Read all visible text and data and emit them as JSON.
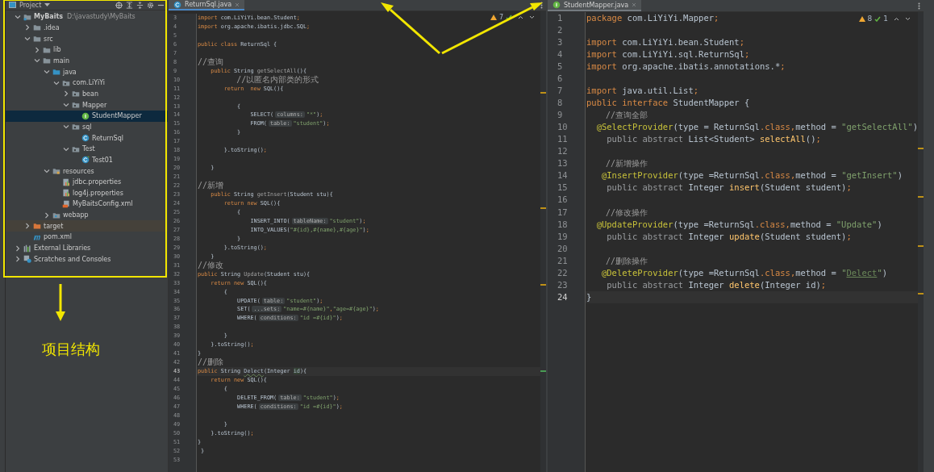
{
  "project_panel": {
    "title": "Project",
    "tree": [
      {
        "label": "MyBaits",
        "path": "D:\\javastudy\\MyBaits",
        "kind": "module",
        "expanded": true,
        "selected": false,
        "children": [
          {
            "label": ".idea",
            "kind": "folder",
            "expanded": false,
            "selected": false
          },
          {
            "label": "src",
            "kind": "folder",
            "expanded": true,
            "selected": false,
            "children": [
              {
                "label": "lib",
                "kind": "folder",
                "expanded": false,
                "selected": false
              },
              {
                "label": "main",
                "kind": "folder",
                "expanded": true,
                "selected": false,
                "children": [
                  {
                    "label": "java",
                    "kind": "source-folder",
                    "expanded": true,
                    "selected": false,
                    "children": [
                      {
                        "label": "com.LiYiYi",
                        "kind": "package",
                        "expanded": true,
                        "selected": false,
                        "children": [
                          {
                            "label": "bean",
                            "kind": "package",
                            "expanded": false,
                            "selected": false
                          },
                          {
                            "label": "Mapper",
                            "kind": "package",
                            "expanded": true,
                            "selected": false,
                            "children": [
                              {
                                "label": "StudentMapper",
                                "kind": "interface",
                                "selected": true
                              }
                            ]
                          },
                          {
                            "label": "sql",
                            "kind": "package",
                            "expanded": true,
                            "selected": false,
                            "children": [
                              {
                                "label": "ReturnSql",
                                "kind": "class",
                                "selected": false
                              }
                            ]
                          },
                          {
                            "label": "Test",
                            "kind": "package",
                            "expanded": true,
                            "selected": false,
                            "children": [
                              {
                                "label": "Test01",
                                "kind": "test-class",
                                "selected": false
                              }
                            ]
                          }
                        ]
                      }
                    ]
                  },
                  {
                    "label": "resources",
                    "kind": "resources-folder",
                    "expanded": true,
                    "selected": false,
                    "children": [
                      {
                        "label": "jdbc.properties",
                        "kind": "properties",
                        "selected": false
                      },
                      {
                        "label": "log4j.properties",
                        "kind": "properties",
                        "selected": false
                      },
                      {
                        "label": "MyBaitsConfig.xml",
                        "kind": "xml",
                        "selected": false
                      }
                    ]
                  },
                  {
                    "label": "webapp",
                    "kind": "web-folder",
                    "expanded": false,
                    "selected": false
                  }
                ]
              }
            ]
          },
          {
            "label": "target",
            "kind": "excluded-folder",
            "expanded": false,
            "selected": false
          },
          {
            "label": "pom.xml",
            "kind": "maven",
            "selected": false
          }
        ]
      },
      {
        "label": "External Libraries",
        "kind": "libraries",
        "expanded": false,
        "selected": false
      },
      {
        "label": "Scratches and Consoles",
        "kind": "scratches",
        "expanded": false,
        "selected": false
      }
    ]
  },
  "editors": [
    {
      "tab": {
        "label": "ReturnSql.java",
        "kind": "class",
        "selected": true
      },
      "focused": true,
      "warnings": "7",
      "lines": [
        {
          "number": "3",
          "current": false,
          "tokens": [
            {
              "kind": "kw",
              "text": "import "
            },
            {
              "kind": "id",
              "text": "com.LiYiYi.bean.Student"
            },
            {
              "kind": "kw",
              "text": ";"
            }
          ]
        },
        {
          "number": "4",
          "current": false,
          "tokens": [
            {
              "kind": "kw",
              "text": "import "
            },
            {
              "kind": "id",
              "text": "org.apache.ibatis.jdbc.SQL"
            },
            {
              "kind": "kw",
              "text": ";"
            }
          ]
        },
        {
          "number": "5",
          "current": false
        },
        {
          "number": "6",
          "current": false,
          "tokens": [
            {
              "kind": "kw",
              "text": "public class "
            },
            {
              "kind": "id",
              "text": "ReturnSql {"
            }
          ]
        },
        {
          "number": "7",
          "current": false
        },
        {
          "number": "8",
          "current": false,
          "tokens": [
            {
              "kind": "com",
              "text": "//查询"
            }
          ]
        },
        {
          "number": "9",
          "current": false,
          "tokens": [
            {
              "kind": "kw",
              "text": "    public "
            },
            {
              "kind": "id",
              "text": "String "
            },
            {
              "kind": "unused",
              "text": "getSelectAll"
            },
            {
              "kind": "id",
              "text": "(){"
            }
          ]
        },
        {
          "number": "10",
          "current": false,
          "tokens": [
            {
              "kind": "com",
              "text": "        //以匿名内部类的形式"
            }
          ]
        },
        {
          "number": "11",
          "current": false,
          "tokens": [
            {
              "kind": "kw",
              "text": "        return  new "
            },
            {
              "kind": "id",
              "text": "SQL(){"
            }
          ]
        },
        {
          "number": "12",
          "current": false
        },
        {
          "number": "13",
          "current": false,
          "tokens": [
            {
              "kind": "id",
              "text": "            {"
            }
          ]
        },
        {
          "number": "14",
          "current": false,
          "tokens": [
            {
              "kind": "id",
              "text": "                SELECT("
            },
            {
              "kind": "hint",
              "text": "columns:"
            },
            {
              "kind": "str",
              "text": "\"*\""
            },
            {
              "kind": "id",
              "text": ")"
            },
            {
              "kind": "kw",
              "text": ";"
            }
          ]
        },
        {
          "number": "15",
          "current": false,
          "tokens": [
            {
              "kind": "id",
              "text": "                FROM("
            },
            {
              "kind": "hint",
              "text": "table:"
            },
            {
              "kind": "str",
              "text": "\"student\""
            },
            {
              "kind": "id",
              "text": ")"
            },
            {
              "kind": "kw",
              "text": ";"
            }
          ]
        },
        {
          "number": "16",
          "current": false,
          "tokens": [
            {
              "kind": "id",
              "text": "            }"
            }
          ]
        },
        {
          "number": "17",
          "current": false
        },
        {
          "number": "18",
          "current": false,
          "tokens": [
            {
              "kind": "id",
              "text": "        }.toString()"
            },
            {
              "kind": "kw",
              "text": ";"
            }
          ]
        },
        {
          "number": "19",
          "current": false
        },
        {
          "number": "20",
          "current": false,
          "tokens": [
            {
              "kind": "id",
              "text": "    }"
            }
          ]
        },
        {
          "number": "21",
          "current": false
        },
        {
          "number": "22",
          "current": false,
          "tokens": [
            {
              "kind": "com",
              "text": "//新增"
            }
          ]
        },
        {
          "number": "23",
          "current": false,
          "tokens": [
            {
              "kind": "kw",
              "text": "    public "
            },
            {
              "kind": "id",
              "text": "String "
            },
            {
              "kind": "unused",
              "text": "getInsert"
            },
            {
              "kind": "id",
              "text": "(Student stu){"
            }
          ]
        },
        {
          "number": "24",
          "current": false,
          "tokens": [
            {
              "kind": "kw",
              "text": "        return new "
            },
            {
              "kind": "id",
              "text": "SQL(){"
            }
          ]
        },
        {
          "number": "25",
          "current": false,
          "tokens": [
            {
              "kind": "id",
              "text": "            {"
            }
          ]
        },
        {
          "number": "26",
          "current": false,
          "tokens": [
            {
              "kind": "id",
              "text": "                INSERT_INTO("
            },
            {
              "kind": "hint",
              "text": "tableName:"
            },
            {
              "kind": "str",
              "text": "\"student\""
            },
            {
              "kind": "id",
              "text": ")"
            },
            {
              "kind": "kw",
              "text": ";"
            }
          ]
        },
        {
          "number": "27",
          "current": false,
          "tokens": [
            {
              "kind": "id",
              "text": "                INTO_VALUES("
            },
            {
              "kind": "str",
              "text": "\"#{id},#{name},#{age}\""
            },
            {
              "kind": "id",
              "text": ")"
            },
            {
              "kind": "kw",
              "text": ";"
            }
          ]
        },
        {
          "number": "28",
          "current": false,
          "tokens": [
            {
              "kind": "id",
              "text": "            }"
            }
          ]
        },
        {
          "number": "29",
          "current": false,
          "tokens": [
            {
              "kind": "id",
              "text": "        }.toString()"
            },
            {
              "kind": "kw",
              "text": ";"
            }
          ]
        },
        {
          "number": "30",
          "current": false,
          "tokens": [
            {
              "kind": "id",
              "text": "    }"
            }
          ]
        },
        {
          "number": "31",
          "current": false,
          "tokens": [
            {
              "kind": "com",
              "text": "//修改"
            }
          ]
        },
        {
          "number": "32",
          "current": false,
          "tokens": [
            {
              "kind": "kw",
              "text": "public "
            },
            {
              "kind": "id",
              "text": "String "
            },
            {
              "kind": "unused",
              "text": "Update"
            },
            {
              "kind": "id",
              "text": "(Student stu){"
            }
          ]
        },
        {
          "number": "33",
          "current": false,
          "tokens": [
            {
              "kind": "kw",
              "text": "    return new "
            },
            {
              "kind": "id",
              "text": "SQL(){"
            }
          ]
        },
        {
          "number": "34",
          "current": false,
          "tokens": [
            {
              "kind": "id",
              "text": "        {"
            }
          ]
        },
        {
          "number": "35",
          "current": false,
          "tokens": [
            {
              "kind": "id",
              "text": "            UPDATE("
            },
            {
              "kind": "hint",
              "text": "table:"
            },
            {
              "kind": "str",
              "text": "\"student\""
            },
            {
              "kind": "id",
              "text": ")"
            },
            {
              "kind": "kw",
              "text": ";"
            }
          ]
        },
        {
          "number": "36",
          "current": false,
          "tokens": [
            {
              "kind": "id",
              "text": "            SET("
            },
            {
              "kind": "hint",
              "text": "...sets:"
            },
            {
              "kind": "str",
              "text": "\"name=#{name}\""
            },
            {
              "kind": "kw",
              "text": ","
            },
            {
              "kind": "str",
              "text": "\"age=#{age}\""
            },
            {
              "kind": "id",
              "text": ")"
            },
            {
              "kind": "kw",
              "text": ";"
            }
          ]
        },
        {
          "number": "37",
          "current": false,
          "tokens": [
            {
              "kind": "id",
              "text": "            WHERE("
            },
            {
              "kind": "hint",
              "text": "conditions:"
            },
            {
              "kind": "str",
              "text": "\"id =#{id}\""
            },
            {
              "kind": "id",
              "text": ")"
            },
            {
              "kind": "kw",
              "text": ";"
            }
          ]
        },
        {
          "number": "38",
          "current": false
        },
        {
          "number": "39",
          "current": false,
          "tokens": [
            {
              "kind": "id",
              "text": "        }"
            }
          ]
        },
        {
          "number": "40",
          "current": false,
          "tokens": [
            {
              "kind": "id",
              "text": "    }.toString()"
            },
            {
              "kind": "kw",
              "text": ";"
            }
          ]
        },
        {
          "number": "41",
          "current": false,
          "tokens": [
            {
              "kind": "id",
              "text": "}"
            }
          ]
        },
        {
          "number": "42",
          "current": false,
          "tokens": [
            {
              "kind": "com",
              "text": "//删除"
            }
          ]
        },
        {
          "number": "43",
          "current": true,
          "tokens": [
            {
              "kind": "kw",
              "text": "public "
            },
            {
              "kind": "id",
              "text": "String "
            },
            {
              "kind": "typo",
              "text": "Delect"
            },
            {
              "kind": "id",
              "text": "(Integer "
            },
            {
              "kind": "param",
              "text": "id"
            },
            {
              "kind": "id",
              "text": "){"
            }
          ]
        },
        {
          "number": "44",
          "current": false,
          "tokens": [
            {
              "kind": "kw",
              "text": "    return new "
            },
            {
              "kind": "id",
              "text": "SQL(){"
            }
          ]
        },
        {
          "number": "45",
          "current": false,
          "tokens": [
            {
              "kind": "id",
              "text": "        {"
            }
          ]
        },
        {
          "number": "46",
          "current": false,
          "tokens": [
            {
              "kind": "id",
              "text": "            DELETE_FROM("
            },
            {
              "kind": "hint",
              "text": "table:"
            },
            {
              "kind": "str",
              "text": "\"student\""
            },
            {
              "kind": "id",
              "text": ")"
            },
            {
              "kind": "kw",
              "text": ";"
            }
          ]
        },
        {
          "number": "47",
          "current": false,
          "tokens": [
            {
              "kind": "id",
              "text": "            WHERE("
            },
            {
              "kind": "hint",
              "text": "conditions:"
            },
            {
              "kind": "str",
              "text": "\"id =#{id}\""
            },
            {
              "kind": "id",
              "text": ")"
            },
            {
              "kind": "kw",
              "text": ";"
            }
          ]
        },
        {
          "number": "48",
          "current": false
        },
        {
          "number": "49",
          "current": false,
          "tokens": [
            {
              "kind": "id",
              "text": "        }"
            }
          ]
        },
        {
          "number": "50",
          "current": false,
          "tokens": [
            {
              "kind": "id",
              "text": "    }.toString()"
            },
            {
              "kind": "kw",
              "text": ";"
            }
          ]
        },
        {
          "number": "51",
          "current": false,
          "tokens": [
            {
              "kind": "id",
              "text": "}"
            }
          ]
        },
        {
          "number": "52",
          "current": false,
          "tokens": [
            {
              "kind": "id",
              "text": " }"
            }
          ]
        },
        {
          "number": "53",
          "current": false
        }
      ]
    },
    {
      "tab": {
        "label": "StudentMapper.java",
        "kind": "interface",
        "selected": true
      },
      "focused": false,
      "warnings": "8",
      "weak_warnings": "1",
      "lines": [
        {
          "number": "1",
          "current": false,
          "tokens": [
            {
              "kind": "kw",
              "text": "package "
            },
            {
              "kind": "id",
              "text": "com.LiYiYi.Mapper"
            },
            {
              "kind": "kw",
              "text": ";"
            }
          ]
        },
        {
          "number": "2",
          "current": false
        },
        {
          "number": "3",
          "current": false,
          "tokens": [
            {
              "kind": "kw",
              "text": "import "
            },
            {
              "kind": "id",
              "text": "com.LiYiYi.bean.Student"
            },
            {
              "kind": "kw",
              "text": ";"
            }
          ]
        },
        {
          "number": "4",
          "current": false,
          "tokens": [
            {
              "kind": "kw",
              "text": "import "
            },
            {
              "kind": "id",
              "text": "com.LiYiYi.sql.ReturnSql"
            },
            {
              "kind": "kw",
              "text": ";"
            }
          ]
        },
        {
          "number": "5",
          "current": false,
          "tokens": [
            {
              "kind": "kw",
              "text": "import "
            },
            {
              "kind": "id",
              "text": "org.apache.ibatis.annotations.*"
            },
            {
              "kind": "kw",
              "text": ";"
            }
          ]
        },
        {
          "number": "6",
          "current": false
        },
        {
          "number": "7",
          "current": false,
          "tokens": [
            {
              "kind": "kw",
              "text": "import "
            },
            {
              "kind": "id",
              "text": "java.util.List"
            },
            {
              "kind": "kw",
              "text": ";"
            }
          ]
        },
        {
          "number": "8",
          "current": false,
          "tokens": [
            {
              "kind": "kw",
              "text": "public interface "
            },
            {
              "kind": "id",
              "text": "StudentMapper {"
            }
          ]
        },
        {
          "number": "9",
          "current": false,
          "tokens": [
            {
              "kind": "com",
              "text": "    //查询全部"
            }
          ]
        },
        {
          "number": "10",
          "current": false,
          "tokens": [
            {
              "kind": "ann",
              "text": "  @SelectProvider"
            },
            {
              "kind": "id",
              "text": "(type = ReturnSql"
            },
            {
              "kind": "kw",
              "text": ".class,"
            },
            {
              "kind": "id",
              "text": "method = "
            },
            {
              "kind": "str",
              "text": "\"getSelectAll\""
            },
            {
              "kind": "id",
              "text": ")"
            }
          ]
        },
        {
          "number": "11",
          "current": false,
          "tokens": [
            {
              "kind": "muted",
              "text": "    public abstract "
            },
            {
              "kind": "id",
              "text": "List<Student> "
            },
            {
              "kind": "fn",
              "text": "selectAll"
            },
            {
              "kind": "id",
              "text": "()"
            },
            {
              "kind": "kw",
              "text": ";"
            }
          ]
        },
        {
          "number": "12",
          "current": false
        },
        {
          "number": "13",
          "current": false,
          "tokens": [
            {
              "kind": "com",
              "text": "    //新增操作"
            }
          ]
        },
        {
          "number": "14",
          "current": false,
          "tokens": [
            {
              "kind": "ann",
              "text": "   @InsertProvider"
            },
            {
              "kind": "id",
              "text": "(type =ReturnSql"
            },
            {
              "kind": "kw",
              "text": ".class,"
            },
            {
              "kind": "id",
              "text": "method = "
            },
            {
              "kind": "str",
              "text": "\"getInsert\""
            },
            {
              "kind": "id",
              "text": ")"
            }
          ]
        },
        {
          "number": "15",
          "current": false,
          "tokens": [
            {
              "kind": "muted",
              "text": "    public abstract "
            },
            {
              "kind": "id",
              "text": "Integer "
            },
            {
              "kind": "fn",
              "text": "insert"
            },
            {
              "kind": "id",
              "text": "(Student student)"
            },
            {
              "kind": "kw",
              "text": ";"
            }
          ]
        },
        {
          "number": "16",
          "current": false
        },
        {
          "number": "17",
          "current": false,
          "tokens": [
            {
              "kind": "com",
              "text": "    //修改操作"
            }
          ]
        },
        {
          "number": "18",
          "current": false,
          "tokens": [
            {
              "kind": "ann",
              "text": "  @UpdateProvider"
            },
            {
              "kind": "id",
              "text": "(type =ReturnSql"
            },
            {
              "kind": "kw",
              "text": ".class,"
            },
            {
              "kind": "id",
              "text": "method = "
            },
            {
              "kind": "str",
              "text": "\"Update\""
            },
            {
              "kind": "id",
              "text": ")"
            }
          ]
        },
        {
          "number": "19",
          "current": false,
          "tokens": [
            {
              "kind": "muted",
              "text": "    public abstract "
            },
            {
              "kind": "id",
              "text": "Integer "
            },
            {
              "kind": "fn",
              "text": "update"
            },
            {
              "kind": "id",
              "text": "(Student student)"
            },
            {
              "kind": "kw",
              "text": ";"
            }
          ]
        },
        {
          "number": "20",
          "current": false
        },
        {
          "number": "21",
          "current": false,
          "tokens": [
            {
              "kind": "com",
              "text": "    //删除操作"
            }
          ]
        },
        {
          "number": "22",
          "current": false,
          "tokens": [
            {
              "kind": "ann",
              "text": "   @DeleteProvider"
            },
            {
              "kind": "id",
              "text": "(type =ReturnSql"
            },
            {
              "kind": "kw",
              "text": ".class,"
            },
            {
              "kind": "id",
              "text": "method = "
            },
            {
              "kind": "str",
              "text": "\""
            },
            {
              "kind": "str-typo",
              "text": "Delect"
            },
            {
              "kind": "str",
              "text": "\""
            },
            {
              "kind": "id",
              "text": ")"
            }
          ]
        },
        {
          "number": "23",
          "current": false,
          "tokens": [
            {
              "kind": "muted",
              "text": "    public abstract "
            },
            {
              "kind": "id",
              "text": "Integer "
            },
            {
              "kind": "fn",
              "text": "delete"
            },
            {
              "kind": "id",
              "text": "(Integer id)"
            },
            {
              "kind": "kw",
              "text": ";"
            }
          ]
        },
        {
          "number": "24",
          "current": true,
          "tokens": [
            {
              "kind": "id",
              "text": "}"
            }
          ]
        }
      ]
    }
  ],
  "annotation": {
    "caption": "项目结构"
  }
}
